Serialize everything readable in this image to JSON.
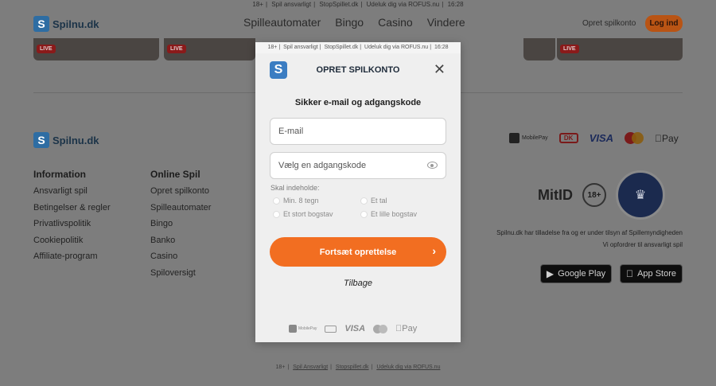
{
  "top_note": [
    "18+",
    "Spil ansvarligt",
    "StopSpillet.dk",
    "Udeluk dig via ROFUS.nu",
    "16:28"
  ],
  "brand": {
    "name": "Spilnu.dk",
    "mark": "S"
  },
  "nav": [
    "Spilleautomater",
    "Bingo",
    "Casino",
    "Vindere"
  ],
  "header": {
    "open_account": "Opret spilkonto",
    "login": "Log ind"
  },
  "live_badge": "LIVE",
  "payments": {
    "mobilepay": "MobilePay",
    "dk": "DK",
    "visa": "VISA",
    "apple_pay": "Pay"
  },
  "footer": {
    "info_title": "Information",
    "info_links": [
      "Ansvarligt spil",
      "Betingelser & regler",
      "Privatlivspolitik",
      "Cookiepolitik",
      "Affiliate-program"
    ],
    "online_title": "Online Spil",
    "online_links": [
      "Opret spilkonto",
      "Spilleautomater",
      "Bingo",
      "Banko",
      "Casino",
      "Spiloversigt"
    ],
    "mitid": "MitID",
    "age": "18+",
    "seal": "♛",
    "license_line1": "Spilnu.dk har tilladelse fra og er under tilsyn af Spillemyndigheden",
    "license_line2": "Vi opfordrer til ansvarligt spil",
    "google_play": "Google Play",
    "app_store": "App Store"
  },
  "bottom_note": [
    "18+",
    "Spil Ansvarligt",
    "Stopspillet.dk",
    "Udeluk dig via ROFUS.nu"
  ],
  "modal": {
    "top_note": [
      "18+",
      "Spil ansvarligt",
      "StopSpillet.dk",
      "Udeluk dig via ROFUS.nu",
      "16:28"
    ],
    "logo": "S",
    "title": "OPRET SPILKONTO",
    "close": "✕",
    "subtitle": "Sikker e-mail og adgangskode",
    "email_placeholder": "E-mail",
    "password_placeholder": "Vælg en adgangskode",
    "requirements_title": "Skal indeholde:",
    "requirements": [
      "Min. 8 tegn",
      "Et tal",
      "Et stort bogstav",
      "Et lille bogstav"
    ],
    "continue_label": "Fortsæt oprettelse",
    "continue_arrow": "›",
    "back_label": "Tilbage",
    "payments": {
      "mobilepay": "MobilePay",
      "visa": "VISA",
      "apple_pay": "Pay"
    }
  }
}
